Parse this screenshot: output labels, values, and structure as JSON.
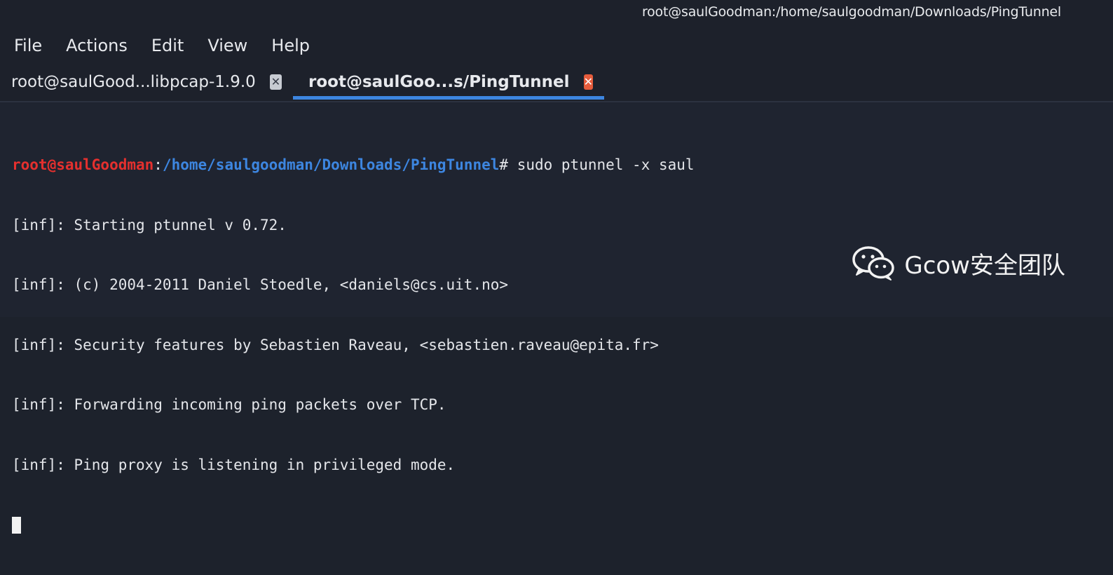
{
  "window": {
    "title": "root@saulGoodman:/home/saulgoodman/Downloads/PingTunnel"
  },
  "menu": [
    "File",
    "Actions",
    "Edit",
    "View",
    "Help"
  ],
  "tabs": [
    {
      "label": "root@saulGood...libpcap-1.9.0",
      "active": false
    },
    {
      "label": "root@saulGoo...s/PingTunnel",
      "active": true
    }
  ],
  "terminal": {
    "prompt_user": "root@saulGoodman",
    "prompt_sep": ":",
    "prompt_path": "/home/saulgoodman/Downloads/PingTunnel",
    "prompt_hash": "#",
    "command": " sudo ptunnel -x saul",
    "output": [
      "[inf]: Starting ptunnel v 0.72.",
      "[inf]: (c) 2004-2011 Daniel Stoedle, <daniels@cs.uit.no>",
      "[inf]: Security features by Sebastien Raveau, <sebastien.raveau@epita.fr>",
      "[inf]: Forwarding incoming ping packets over TCP.",
      "[inf]: Ping proxy is listening in privileged mode."
    ]
  },
  "watermark": {
    "icon": "wechat-icon",
    "text": "Gcow安全团队"
  },
  "colors": {
    "background": "#1f2430",
    "prompt_user": "#e5302e",
    "prompt_path": "#3d86e0",
    "active_tab_underline": "#3d86e0",
    "active_tab_close": "#e65c3c"
  }
}
